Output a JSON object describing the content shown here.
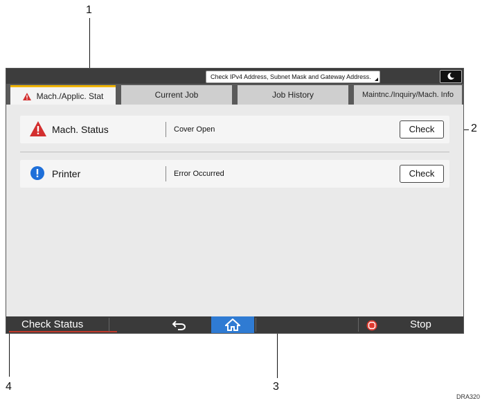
{
  "callouts": {
    "c1": "1",
    "c2": "2",
    "c3": "3",
    "c4": "4"
  },
  "figure_code": "DRA320",
  "topbar": {
    "message": "Check IPv4 Address, Subnet Mask and Gateway Address."
  },
  "tabs": [
    {
      "label": "Mach./Applic. Stat",
      "active": true
    },
    {
      "label": "Current Job"
    },
    {
      "label": "Job History"
    },
    {
      "label": "Maintnc./Inquiry/Mach. Info"
    }
  ],
  "rows": [
    {
      "name": "Mach. Status",
      "status": "Cover Open",
      "button": "Check",
      "icon": "warning-triangle-icon"
    },
    {
      "name": "Printer",
      "status": "Error Occurred",
      "button": "Check",
      "icon": "info-exclamation-icon"
    }
  ],
  "bottombar": {
    "check_status": "Check Status",
    "stop": "Stop"
  },
  "colors": {
    "warning_red": "#d32f2f",
    "info_blue": "#1e6fd9",
    "tab_accent": "#f0b400",
    "home_blue": "#2f7bd3",
    "stop_red": "#e03a2e"
  }
}
